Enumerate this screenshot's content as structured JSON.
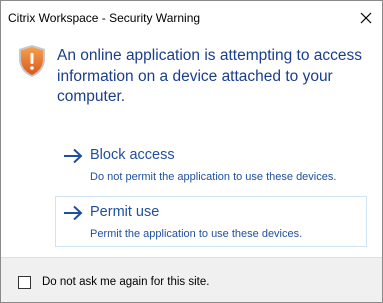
{
  "window": {
    "title": "Citrix Workspace - Security Warning"
  },
  "message": {
    "headline": "An online application is attempting to access information on a device attached to your computer.",
    "icon": "shield-warning-icon"
  },
  "options": [
    {
      "title": "Block access",
      "description": "Do not permit the application to use these devices.",
      "icon": "arrow-right-icon"
    },
    {
      "title": "Permit use",
      "description": "Permit the application to use these devices.",
      "icon": "arrow-right-icon"
    }
  ],
  "footer": {
    "checkbox_label": "Do not ask me again for this site.",
    "checkbox_checked": false
  },
  "colors": {
    "link_blue": "#1f4f9e",
    "headline_blue": "#1a3e8c",
    "shield_orange": "#e8742a",
    "footer_bg": "#f0f0f0"
  }
}
